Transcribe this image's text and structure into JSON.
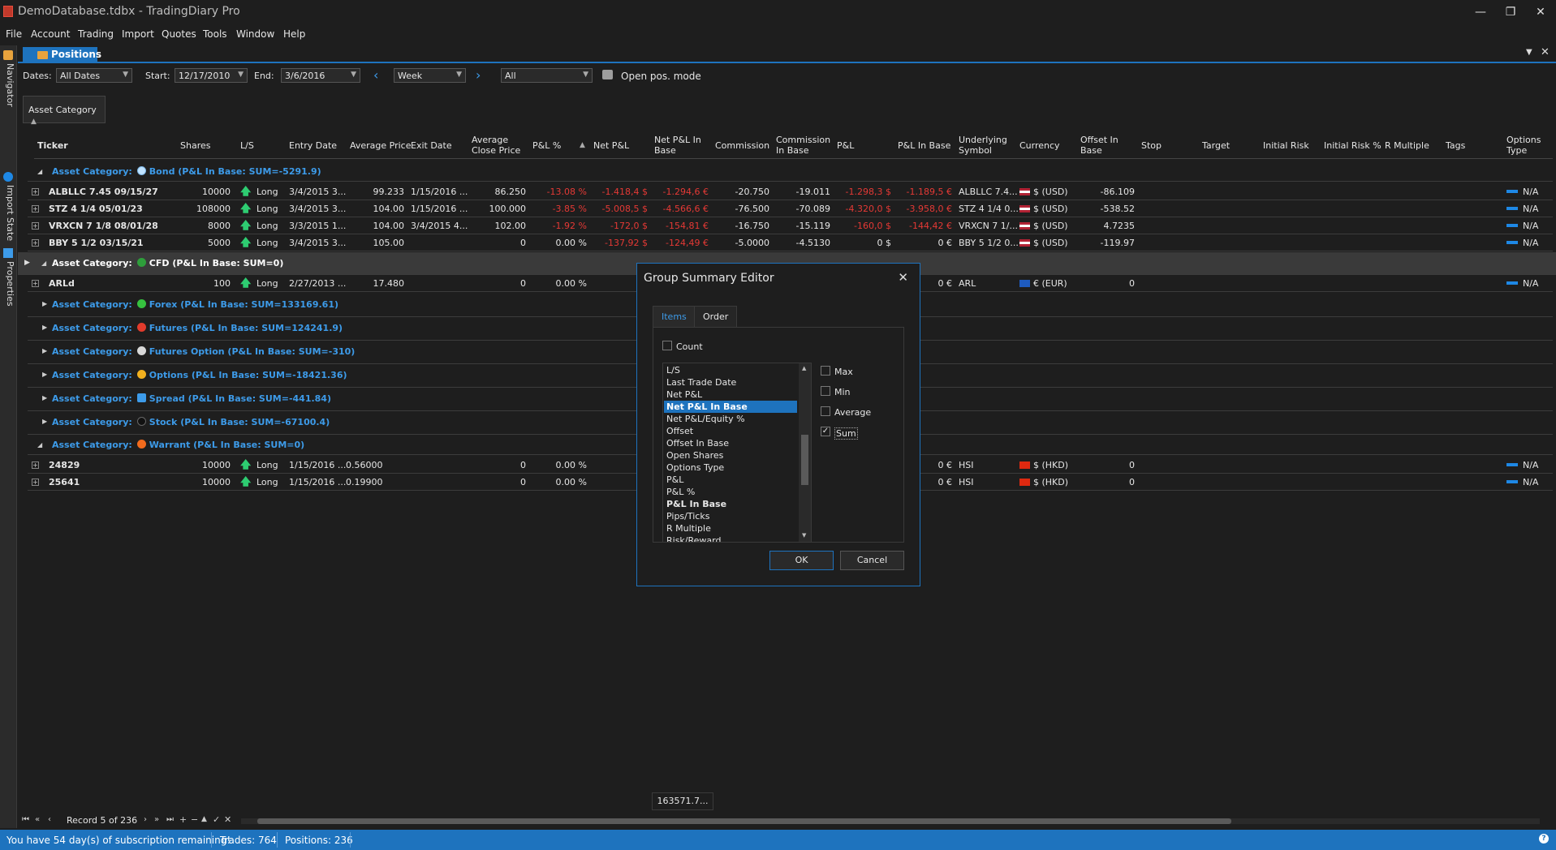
{
  "window": {
    "title": "DemoDatabase.tdbx - TradingDiary Pro",
    "minimize": "—",
    "restore": "❐",
    "close": "✕"
  },
  "menu": [
    "File",
    "Account",
    "Trading",
    "Import",
    "Quotes",
    "Tools",
    "Window",
    "Help"
  ],
  "sidebar": {
    "tabs": [
      "Navigator",
      "Import State",
      "Properties"
    ]
  },
  "doc_tab": {
    "label": "Positions"
  },
  "toolbar": {
    "dates_label": "Dates:",
    "dates_value": "All Dates",
    "start_label": "Start:",
    "start_value": "12/17/2010",
    "end_label": "End:",
    "end_value": "3/6/2016",
    "period_value": "Week",
    "filter_value": "All",
    "open_pos_label": "Open pos. mode"
  },
  "group_panel": {
    "label": "Asset Category"
  },
  "columns": [
    "Ticker",
    "Shares",
    "L/S",
    "Entry Date",
    "Average Price",
    "Exit Date",
    "Average Close Price",
    "P&L %",
    "Net P&L",
    "Net P&L In Base",
    "Commission",
    "Commission In Base",
    "P&L",
    "P&L In Base",
    "Underlying Symbol",
    "Currency",
    "Offset In Base",
    "Stop",
    "Target",
    "Initial Risk",
    "Initial Risk %",
    "R Multiple",
    "Tags",
    "Options Type"
  ],
  "groups": {
    "bond": "Asset Category:",
    "bond_name": "Bond (P&L In Base: SUM=-5291.9)",
    "cfd_name": "CFD (P&L In Base: SUM=0)",
    "forex_name": "Forex (P&L In Base: SUM=133169.61)",
    "futures_name": "Futures (P&L In Base: SUM=124241.9)",
    "futopt_name": "Futures Option (P&L In Base: SUM=-310)",
    "options_name": "Options (P&L In Base: SUM=-18421.36)",
    "spread_name": "Spread (P&L In Base: SUM=-441.84)",
    "stock_name": "Stock (P&L In Base: SUM=-67100.4)",
    "warrant_name": "Warrant (P&L In Base: SUM=0)"
  },
  "rows": {
    "r1": {
      "ticker": "ALBLLC 7.45 09/15/27",
      "shares": "10000",
      "ls": "Long",
      "entry": "3/4/2015 3...",
      "avg": "99.233",
      "exit": "1/15/2016 ...",
      "close": "86.250",
      "plpct": "-13.08 %",
      "netpl": "-1.418,4 $",
      "netplb": "-1.294,6 €",
      "comm": "-20.750",
      "commb": "-19.011",
      "pl": "-1.298,3 $",
      "plb": "-1.189,5 €",
      "und": "ALBLLC 7.4...",
      "cur": "$ (USD)",
      "off": "-86.109",
      "opt": "N/A"
    },
    "r2": {
      "ticker": "STZ 4 1/4 05/01/23",
      "shares": "108000",
      "ls": "Long",
      "entry": "3/4/2015 3...",
      "avg": "104.00",
      "exit": "1/15/2016 ...",
      "close": "100.000",
      "plpct": "-3.85 %",
      "netpl": "-5.008,5 $",
      "netplb": "-4.566,6 €",
      "comm": "-76.500",
      "commb": "-70.089",
      "pl": "-4.320,0 $",
      "plb": "-3.958,0 €",
      "und": "STZ 4 1/4 0...",
      "cur": "$ (USD)",
      "off": "-538.52",
      "opt": "N/A"
    },
    "r3": {
      "ticker": "VRXCN 7 1/8 08/01/28",
      "shares": "8000",
      "ls": "Long",
      "entry": "3/3/2015 1...",
      "avg": "104.00",
      "exit": "3/4/2015 4...",
      "close": "102.00",
      "plpct": "-1.92 %",
      "netpl": "-172,0 $",
      "netplb": "-154,81 €",
      "comm": "-16.750",
      "commb": "-15.119",
      "pl": "-160,0 $",
      "plb": "-144,42 €",
      "und": "VRXCN 7 1/...",
      "cur": "$ (USD)",
      "off": "4.7235",
      "opt": "N/A"
    },
    "r4": {
      "ticker": "BBY 5 1/2 03/15/21",
      "shares": "5000",
      "ls": "Long",
      "entry": "3/4/2015 3...",
      "avg": "105.00",
      "exit": "",
      "close": "0",
      "plpct": "0.00 %",
      "netpl": "-137,92 $",
      "netplb": "-124,49 €",
      "comm": "-5.0000",
      "commb": "-4.5130",
      "pl": "0 $",
      "plb": "0 €",
      "und": "BBY 5 1/2 0...",
      "cur": "$ (USD)",
      "off": "-119.97",
      "opt": "N/A"
    },
    "r5": {
      "ticker": "ARLd",
      "shares": "100",
      "ls": "Long",
      "entry": "2/27/2013 ...",
      "avg": "17.480",
      "close": "0",
      "plpct": "0.00 %",
      "plb": "0 €",
      "und": "ARL",
      "cur": "€ (EUR)",
      "off": "0",
      "opt": "N/A"
    },
    "r6": {
      "ticker": "24829",
      "shares": "10000",
      "ls": "Long",
      "entry": "1/15/2016 ...",
      "avg": "0.56000",
      "close": "0",
      "plpct": "0.00 %",
      "plb": "0 €",
      "und": "HSI",
      "cur": "$ (HKD)",
      "off": "0",
      "opt": "N/A"
    },
    "r7": {
      "ticker": "25641",
      "shares": "10000",
      "ls": "Long",
      "entry": "1/15/2016 ...",
      "avg": "0.19900",
      "close": "0",
      "plpct": "0.00 %",
      "plb": "0 €",
      "und": "HSI",
      "cur": "$ (HKD)",
      "off": "0",
      "opt": "N/A"
    }
  },
  "dialog": {
    "title": "Group Summary Editor",
    "tab_items": "Items",
    "tab_order": "Order",
    "count_label": "Count",
    "list": [
      "L/S",
      "Last Trade Date",
      "Net P&L",
      "Net P&L In Base",
      "Net P&L/Equity %",
      "Offset",
      "Offset In Base",
      "Open Shares",
      "Options Type",
      "P&L",
      "P&L %",
      "P&L In Base",
      "Pips/Ticks",
      "R Multiple",
      "Risk/Reward"
    ],
    "max": "Max",
    "min": "Min",
    "average": "Average",
    "sum": "Sum",
    "ok": "OK",
    "cancel": "Cancel"
  },
  "footer_sum": "163571.7...",
  "navigator": {
    "record": "Record 5 of 236"
  },
  "status": {
    "sub": "You have 54 day(s) of subscription remaining!",
    "trades": "Trades: 764",
    "positions": "Positions: 236"
  },
  "colors": {
    "accent": "#1e73be",
    "negative": "#e53935",
    "group": "#3d9be9"
  }
}
